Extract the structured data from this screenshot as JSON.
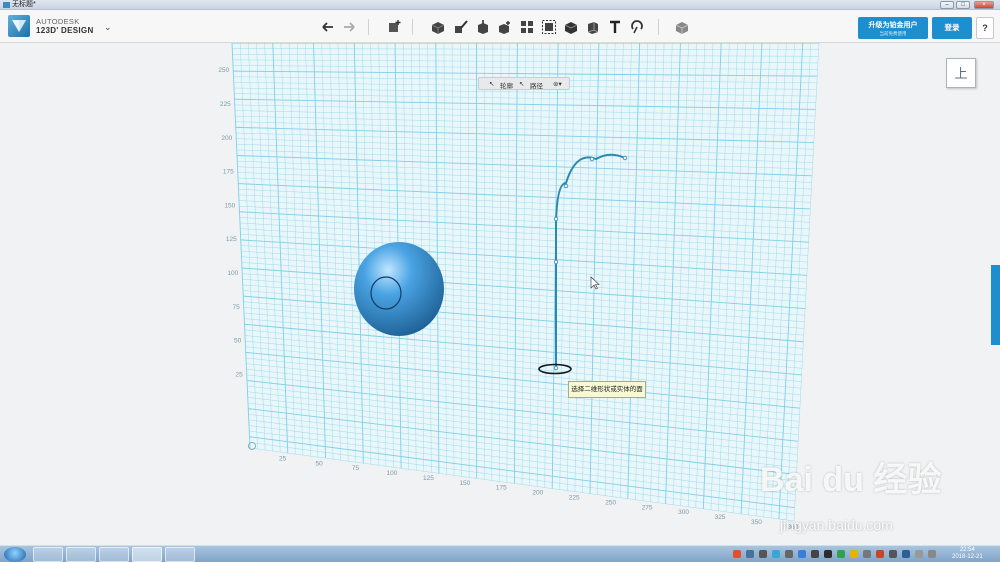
{
  "window": {
    "title": "无标题*"
  },
  "brand": {
    "line1": "AUTODESK",
    "line2": "123D' DESIGN"
  },
  "toolbar": {
    "undo_icon": "undo-icon",
    "redo_icon": "redo-icon",
    "tool_icons": [
      "add-primitive-icon",
      "primitives-icon",
      "sketch-icon",
      "construct-icon",
      "modify-icon",
      "pattern-icon",
      "group-icon",
      "combine-icon",
      "measure-icon",
      "text-icon",
      "snap-icon",
      "material-icon"
    ]
  },
  "account": {
    "upgrade_label": "升级为铂金用户",
    "upgrade_sub": "当前免费使用",
    "login_label": "登录",
    "help_label": "?"
  },
  "sketch_bar": {
    "profile_label": "轮廓",
    "path_label": "路径",
    "options_icon": "settings-icon"
  },
  "view_cube": {
    "face_label": "上"
  },
  "tooltip": {
    "text": "选择二维形状或实体的面"
  },
  "axis": {
    "vertical_ticks": [
      "250",
      "225",
      "200",
      "175",
      "150",
      "125",
      "100",
      "75",
      "50",
      "25"
    ],
    "horizontal_ticks": [
      "25",
      "50",
      "75",
      "100",
      "125",
      "150",
      "175",
      "200",
      "225",
      "250",
      "275",
      "300",
      "325",
      "350",
      "360"
    ]
  },
  "watermark": {
    "logo": "Bai du 经验",
    "url": "jingyan.baidu.com"
  },
  "taskbar": {
    "time": "22:54",
    "date": "2018-12-21",
    "apps": [
      "ie-icon",
      "media-player-icon",
      "wechat-icon",
      "123d-design-icon",
      "film-icon"
    ]
  },
  "colors": {
    "accent": "#1d8fcf",
    "grid": "#7fd0e8",
    "solid": "#4aa3e3"
  }
}
